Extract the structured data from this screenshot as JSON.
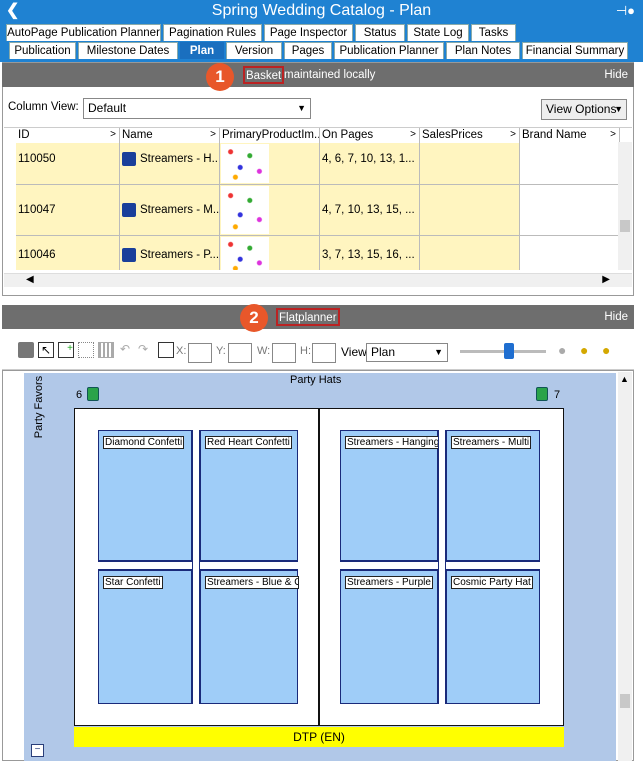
{
  "window": {
    "title": "Spring Wedding Catalog - Plan",
    "back_icon": "back-arrow-icon",
    "pin_icon": "pin-icon"
  },
  "tabs_row1": [
    "AutoPage Publication Planner",
    "Pagination Rules",
    "Page Inspector",
    "Status",
    "State Log",
    "Tasks"
  ],
  "tabs_row2": [
    "Publication",
    "Milestone Dates",
    "Plan",
    "Version",
    "Pages",
    "Publication Planner",
    "Plan Notes",
    "Financial Summary"
  ],
  "active_tab": "Plan",
  "basket": {
    "badge": "1",
    "label": "Basket",
    "label_suffix": " maintained locally",
    "hide": "Hide",
    "column_view_label": "Column View:",
    "column_view_value": "Default",
    "view_options_label": "View Options",
    "columns": [
      "ID",
      "Name",
      "PrimaryProductIm...",
      "On Pages",
      "SalesPrices",
      "Brand Name"
    ],
    "rows": [
      {
        "id": "110050",
        "name": "Streamers - H...",
        "pages": "4, 6, 7, 10, 13, 1..."
      },
      {
        "id": "110047",
        "name": "Streamers - M...",
        "pages": "4, 7, 10, 13, 15, ..."
      },
      {
        "id": "110046",
        "name": "Streamers - P...",
        "pages": "3, 7, 13, 15, 16, ..."
      }
    ]
  },
  "flatplanner": {
    "badge": "2",
    "label": "Flatplanner",
    "hide": "Hide",
    "toolbar": {
      "x_label": "X:",
      "y_label": "Y:",
      "w_label": "W:",
      "h_label": "H:",
      "view_label": "View",
      "view_value": "Plan"
    },
    "spread": {
      "section_title": "Party Hats",
      "side_label": "Party Favors",
      "left_page_number": "6",
      "right_page_number": "7",
      "footer": "DTP (EN)",
      "left_frames": [
        "Diamond Confetti",
        "Red Heart Confetti",
        "Star Confetti",
        "Streamers - Blue & Or"
      ],
      "right_frames": [
        "Streamers - Hanging",
        "Streamers - Multi",
        "Streamers - Purple",
        "Cosmic Party Hat"
      ]
    }
  },
  "colors": {
    "titlebar": "#1f82d2",
    "panel_header": "#6e6e6e",
    "badge": "#e8572a",
    "canvas": "#b1c8e8",
    "frame": "#9fcdf8",
    "footer": "#ffff00",
    "grid_row": "#fff5c0"
  }
}
